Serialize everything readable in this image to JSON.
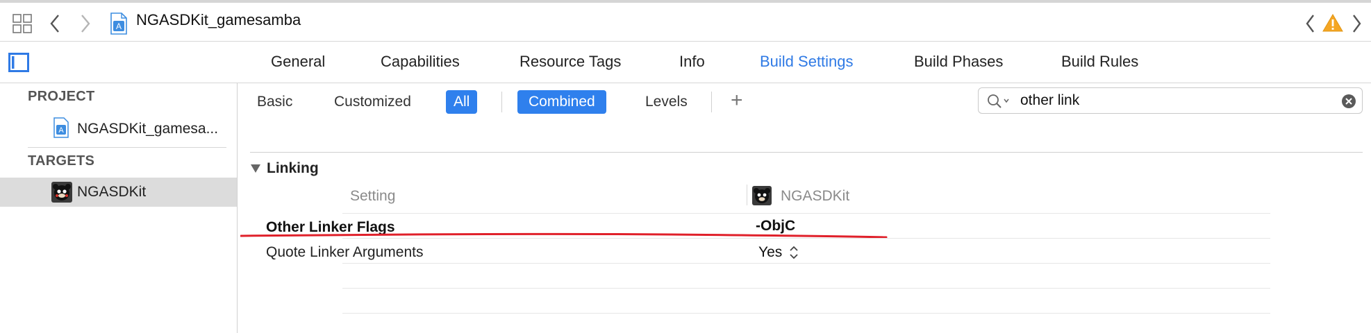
{
  "toolbar": {
    "file_title": "NGASDKit_gamesamba",
    "icons": [
      "grid-icon",
      "back-icon",
      "forward-icon",
      "project-file-icon",
      "previous-issue-icon",
      "warning-icon",
      "next-issue-icon"
    ]
  },
  "tabs": [
    {
      "label": "General",
      "active": false
    },
    {
      "label": "Capabilities",
      "active": false
    },
    {
      "label": "Resource Tags",
      "active": false
    },
    {
      "label": "Info",
      "active": false
    },
    {
      "label": "Build Settings",
      "active": true
    },
    {
      "label": "Build Phases",
      "active": false
    },
    {
      "label": "Build Rules",
      "active": false
    }
  ],
  "sidebar": {
    "project_header": "PROJECT",
    "project_item": "NGASDKit_gamesa...",
    "targets_header": "TARGETS",
    "target_item": "NGASDKit"
  },
  "filter": {
    "basic": "Basic",
    "customized": "Customized",
    "all": "All",
    "combined": "Combined",
    "levels": "Levels",
    "add": "+",
    "search_value": "other link"
  },
  "section": {
    "title": "Linking",
    "col_setting": "Setting",
    "col_target": "NGASDKit"
  },
  "settings": [
    {
      "name": "Other Linker Flags",
      "value": "-ObjC",
      "bold": true
    },
    {
      "name": "Quote Linker Arguments",
      "value": "Yes",
      "bold": false
    }
  ],
  "colors": {
    "accent": "#2f7ae5",
    "annotation_underline": "#e0202a",
    "warning": "#f5a623"
  }
}
